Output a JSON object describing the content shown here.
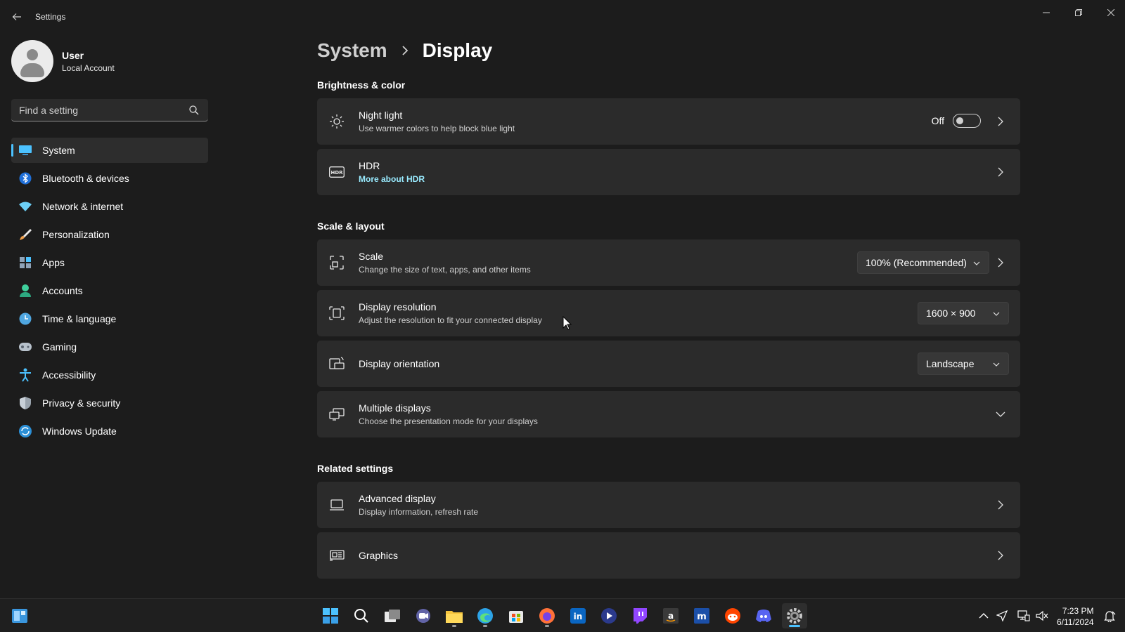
{
  "window": {
    "title": "Settings",
    "back_icon": "arrow-left-icon",
    "controls": [
      "minimize-icon",
      "restore-icon",
      "close-icon"
    ]
  },
  "profile": {
    "name": "User",
    "account_type": "Local Account"
  },
  "search": {
    "placeholder": "Find a setting",
    "icon": "search-icon"
  },
  "sidebar": {
    "items": [
      {
        "label": "System",
        "icon": "system-icon",
        "active": true
      },
      {
        "label": "Bluetooth & devices",
        "icon": "bluetooth-icon"
      },
      {
        "label": "Network & internet",
        "icon": "wifi-icon"
      },
      {
        "label": "Personalization",
        "icon": "brush-icon"
      },
      {
        "label": "Apps",
        "icon": "apps-icon"
      },
      {
        "label": "Accounts",
        "icon": "accounts-icon"
      },
      {
        "label": "Time & language",
        "icon": "time-language-icon"
      },
      {
        "label": "Gaming",
        "icon": "gamepad-icon"
      },
      {
        "label": "Accessibility",
        "icon": "accessibility-icon"
      },
      {
        "label": "Privacy & security",
        "icon": "shield-icon"
      },
      {
        "label": "Windows Update",
        "icon": "update-icon"
      }
    ]
  },
  "breadcrumb": {
    "parent": "System",
    "current": "Display"
  },
  "sections": {
    "brightness": {
      "title": "Brightness & color",
      "night_light": {
        "title": "Night light",
        "subtitle": "Use warmer colors to help block blue light",
        "toggle_label": "Off"
      },
      "hdr": {
        "title": "HDR",
        "link": "More about HDR"
      }
    },
    "scale_layout": {
      "title": "Scale & layout",
      "scale": {
        "title": "Scale",
        "subtitle": "Change the size of text, apps, and other items",
        "value": "100% (Recommended)"
      },
      "resolution": {
        "title": "Display resolution",
        "subtitle": "Adjust the resolution to fit your connected display",
        "value": "1600 × 900"
      },
      "orientation": {
        "title": "Display orientation",
        "value": "Landscape"
      },
      "multiple": {
        "title": "Multiple displays",
        "subtitle": "Choose the presentation mode for your displays"
      }
    },
    "related": {
      "title": "Related settings",
      "advanced": {
        "title": "Advanced display",
        "subtitle": "Display information, refresh rate"
      },
      "graphics": {
        "title": "Graphics"
      }
    }
  },
  "taskbar": {
    "apps": [
      "start-icon",
      "search-icon",
      "task-view-icon",
      "chat-icon",
      "file-explorer-icon",
      "edge-icon",
      "store-icon",
      "firefox-icon",
      "linkedin-icon",
      "media-player-icon",
      "twitch-icon",
      "amazon-icon",
      "m-app-icon",
      "reddit-icon",
      "discord-icon",
      "settings-gear-icon"
    ],
    "clock": {
      "time": "7:23 PM",
      "date": "6/11/2024"
    }
  },
  "colors": {
    "accent": "#4cc2ff",
    "link": "#99ebff",
    "background": "#1c1c1c",
    "card": "#2b2b2b"
  }
}
